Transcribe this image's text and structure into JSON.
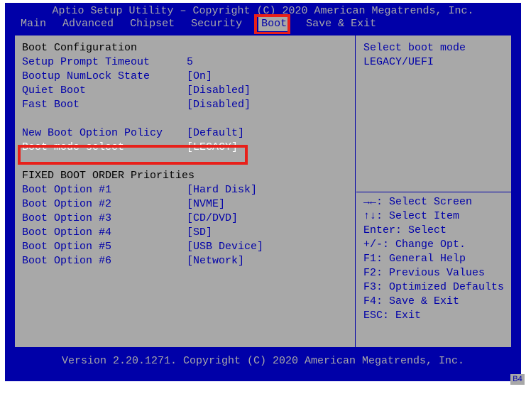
{
  "title": "Aptio Setup Utility – Copyright (C) 2020 American Megatrends, Inc.",
  "menus": [
    "Main",
    "Advanced",
    "Chipset",
    "Security",
    "Boot",
    "Save & Exit"
  ],
  "menu_selected_index": 4,
  "left": {
    "config_heading": "Boot Configuration",
    "rows1": [
      {
        "label": "Setup Prompt Timeout",
        "value": "5"
      },
      {
        "label": "Bootup NumLock State",
        "value": "[On]"
      },
      {
        "label": "Quiet Boot",
        "value": "[Disabled]"
      },
      {
        "label": "Fast Boot",
        "value": "[Disabled]"
      }
    ],
    "rows2": [
      {
        "label": "New Boot Option Policy",
        "value": "[Default]"
      }
    ],
    "selected": {
      "label": "Boot mode select",
      "value": "[LEGACY]"
    },
    "priorities_heading": "FIXED BOOT ORDER Priorities",
    "boot_order": [
      {
        "label": "Boot Option #1",
        "value": "[Hard Disk]"
      },
      {
        "label": "Boot Option #2",
        "value": "[NVME]"
      },
      {
        "label": "Boot Option #3",
        "value": "[CD/DVD]"
      },
      {
        "label": "Boot Option #4",
        "value": "[SD]"
      },
      {
        "label": "Boot Option #5",
        "value": "[USB Device]"
      },
      {
        "label": "Boot Option #6",
        "value": "[Network]"
      }
    ]
  },
  "right": {
    "description1": "Select boot mode",
    "description2": "LEGACY/UEFI",
    "help": [
      "→←: Select Screen",
      "↑↓: Select Item",
      "Enter: Select",
      "+/-: Change Opt.",
      "F1: General Help",
      "F2: Previous Values",
      "F3: Optimized Defaults",
      "F4: Save & Exit",
      "ESC: Exit"
    ]
  },
  "version": "Version 2.20.1271. Copyright (C) 2020 American Megatrends, Inc.",
  "corner": "B4"
}
